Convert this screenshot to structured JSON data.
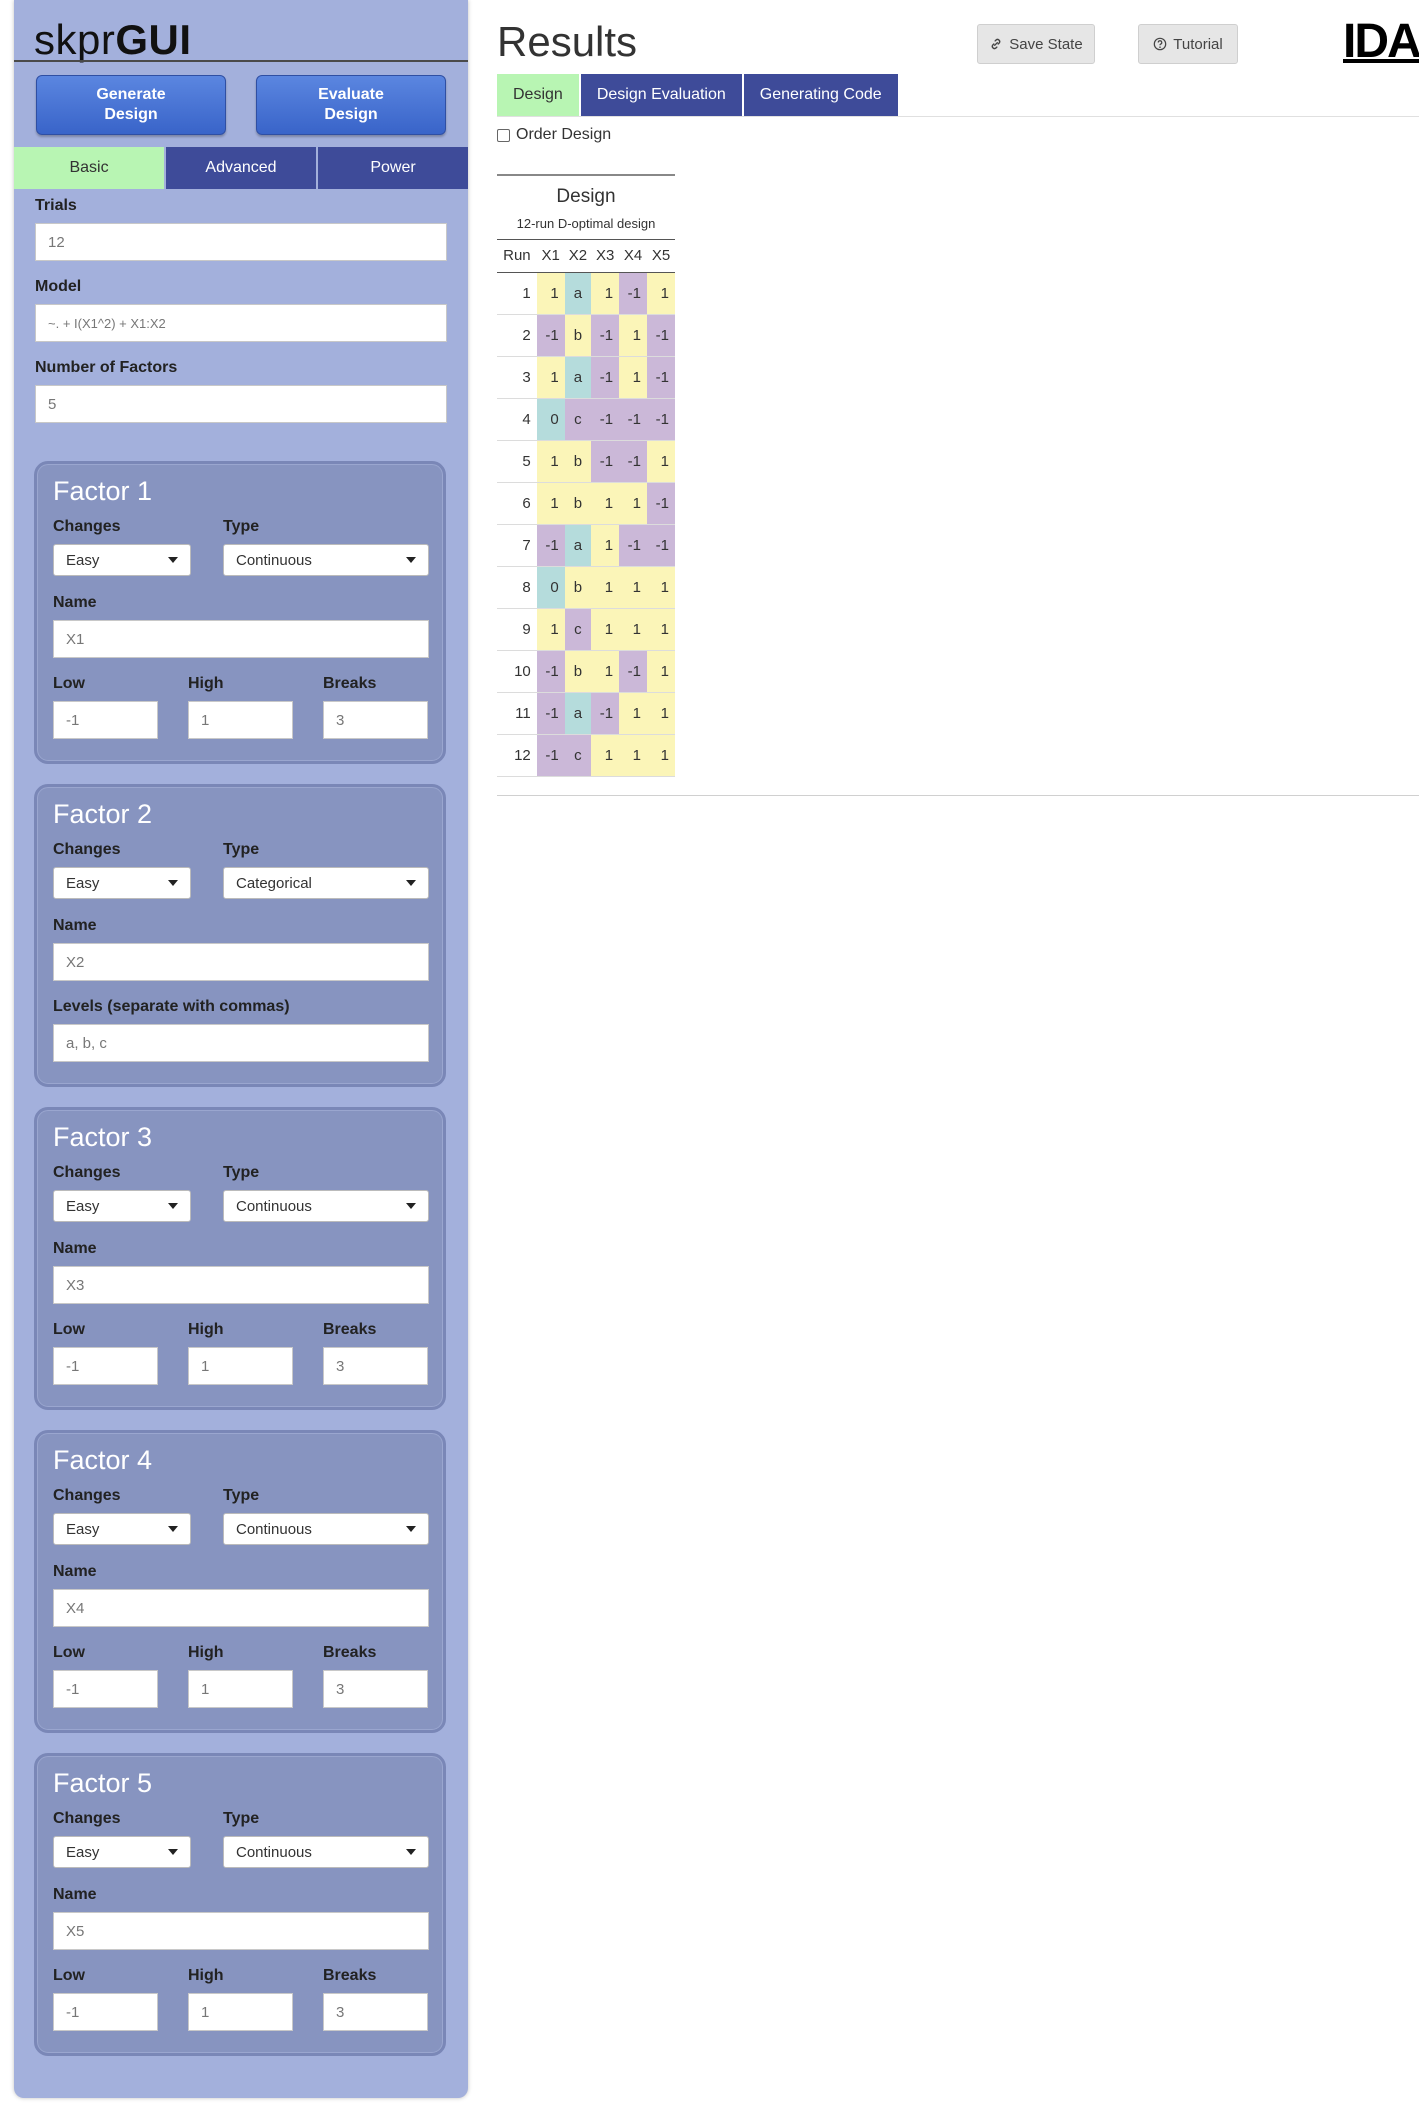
{
  "brand": {
    "light": "skpr",
    "bold": "GUI"
  },
  "sidebar": {
    "generate_label": "Generate Design",
    "evaluate_label": "Evaluate Design",
    "tabs": [
      {
        "label": "Basic"
      },
      {
        "label": "Advanced"
      },
      {
        "label": "Power"
      }
    ],
    "trials": {
      "label": "Trials",
      "value": "12"
    },
    "model": {
      "label": "Model",
      "value": "~. + I(X1^2) + X1:X2"
    },
    "num_factors": {
      "label": "Number of Factors",
      "value": "5"
    }
  },
  "factor_labels": {
    "changes": "Changes",
    "type": "Type",
    "name": "Name",
    "low": "Low",
    "high": "High",
    "breaks": "Breaks",
    "levels": "Levels (separate with commas)"
  },
  "factors": [
    {
      "title": "Factor 1",
      "changes": "Easy",
      "type": "Continuous",
      "name": "X1",
      "low": "-1",
      "high": "1",
      "breaks": "3"
    },
    {
      "title": "Factor 2",
      "changes": "Easy",
      "type": "Categorical",
      "name": "X2",
      "levels": "a, b, c"
    },
    {
      "title": "Factor 3",
      "changes": "Easy",
      "type": "Continuous",
      "name": "X3",
      "low": "-1",
      "high": "1",
      "breaks": "3"
    },
    {
      "title": "Factor 4",
      "changes": "Easy",
      "type": "Continuous",
      "name": "X4",
      "low": "-1",
      "high": "1",
      "breaks": "3"
    },
    {
      "title": "Factor 5",
      "changes": "Easy",
      "type": "Continuous",
      "name": "X5",
      "low": "-1",
      "high": "1",
      "breaks": "3"
    }
  ],
  "main": {
    "title": "Results",
    "save_label": "Save State",
    "tutorial_label": "Tutorial",
    "logo_text": "IDA",
    "tabs": [
      {
        "label": "Design"
      },
      {
        "label": "Design Evaluation"
      },
      {
        "label": "Generating Code"
      }
    ],
    "order_label": "Order Design"
  },
  "design_table": {
    "title": "Design",
    "subtitle": "12-run D-optimal design",
    "columns": [
      "Run",
      "X1",
      "X2",
      "X3",
      "X4",
      "X5"
    ],
    "rows": [
      [
        "1",
        "1",
        "a",
        "1",
        "-1",
        "1"
      ],
      [
        "2",
        "-1",
        "b",
        "-1",
        "1",
        "-1"
      ],
      [
        "3",
        "1",
        "a",
        "-1",
        "1",
        "-1"
      ],
      [
        "4",
        "0",
        "c",
        "-1",
        "-1",
        "-1"
      ],
      [
        "5",
        "1",
        "b",
        "-1",
        "-1",
        "1"
      ],
      [
        "6",
        "1",
        "b",
        "1",
        "1",
        "-1"
      ],
      [
        "7",
        "-1",
        "a",
        "1",
        "-1",
        "-1"
      ],
      [
        "8",
        "0",
        "b",
        "1",
        "1",
        "1"
      ],
      [
        "9",
        "1",
        "c",
        "1",
        "1",
        "1"
      ],
      [
        "10",
        "-1",
        "b",
        "1",
        "-1",
        "1"
      ],
      [
        "11",
        "-1",
        "a",
        "-1",
        "1",
        "1"
      ],
      [
        "12",
        "-1",
        "c",
        "1",
        "1",
        "1"
      ]
    ],
    "colors": {
      "1": "#fbf5b8",
      "-1": "#cbb8d8",
      "0": "#b5dcdc",
      "a": "#b5dcdc",
      "b": "#fbf5b8",
      "c": "#cbb8d8"
    }
  }
}
